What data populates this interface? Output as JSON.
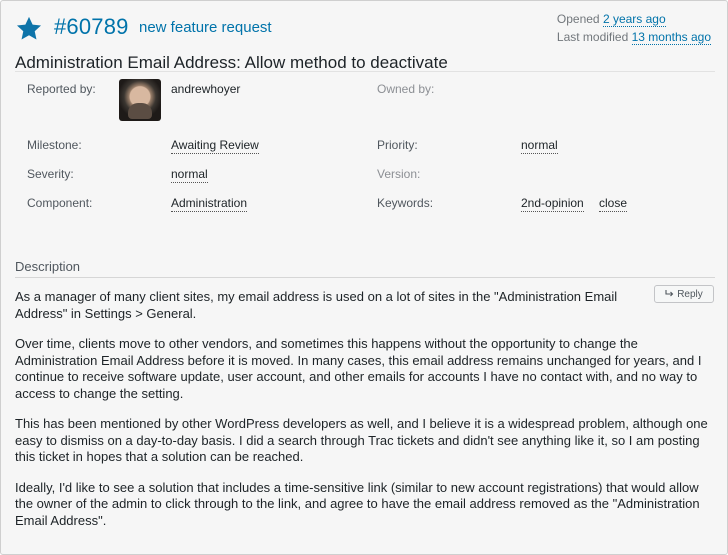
{
  "ticket": {
    "number": "#60789",
    "type": "new feature request",
    "summary": "Administration Email Address: Allow method to deactivate",
    "opened_label": "Opened",
    "opened_ago": "2 years ago",
    "modified_label": "Last modified",
    "modified_ago": "13 months ago"
  },
  "properties": {
    "reported_by_label": "Reported by:",
    "reported_by": "andrewhoyer",
    "owned_by_label": "Owned by:",
    "milestone_label": "Milestone:",
    "milestone": "Awaiting Review",
    "priority_label": "Priority:",
    "priority": "normal",
    "severity_label": "Severity:",
    "severity": "normal",
    "version_label": "Version:",
    "component_label": "Component:",
    "component": "Administration",
    "keywords_label": "Keywords:",
    "keywords": [
      "2nd-opinion",
      "close"
    ]
  },
  "description": {
    "heading": "Description",
    "reply_label": "Reply",
    "paragraphs": [
      "As a manager of many client sites, my email address is used on a lot of sites in the \"Administration Email Address\" in Settings > General.",
      "Over time, clients move to other vendors, and sometimes this happens without the opportunity to change the Administration Email Address before it is moved. In many cases, this email address remains unchanged for years, and I continue to receive software update, user account, and other emails for accounts I have no contact with, and no way to access to change the setting.",
      "This has been mentioned by other WordPress developers as well, and I believe it is a widespread problem, although one easy to dismiss on a day-to-day basis. I did a search through Trac tickets and didn't see anything like it, so I am posting this ticket in hopes that a solution can be reached.",
      "Ideally, I'd like to see a solution that includes a time-sensitive link (similar to new account registrations) that would allow the owner of the admin to click through to the link, and agree to have the email address removed as the \"Administration Email Address\"."
    ]
  },
  "colors": {
    "accent": "#0073aa",
    "star": "#0e74a9"
  },
  "icons": {
    "star": "star-icon",
    "reply": "reply-arrow-icon",
    "avatar": "user-avatar"
  }
}
